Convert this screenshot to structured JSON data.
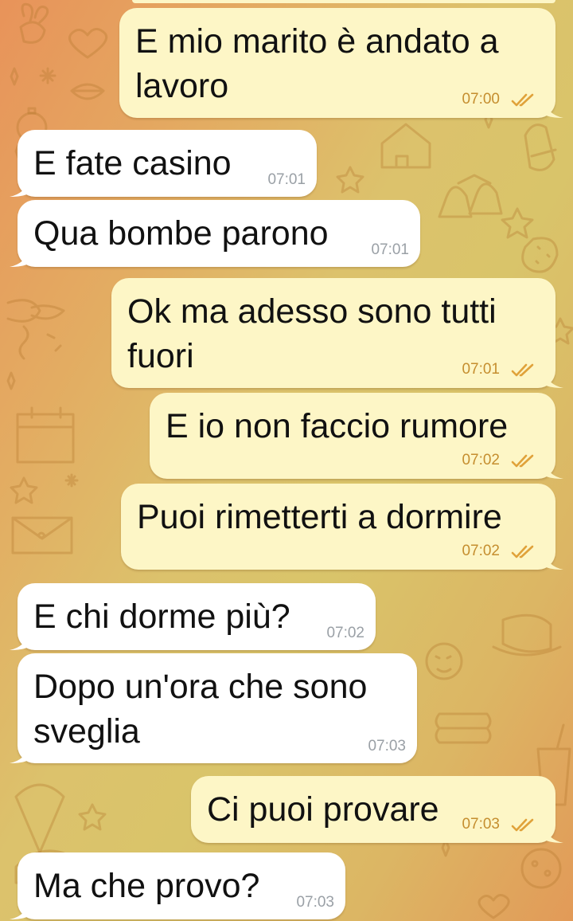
{
  "messages": [
    {
      "text": "E mio marito è andato a\nlavoro",
      "time": "07:00",
      "direction": "out",
      "status": "read"
    },
    {
      "text": "E fate casino",
      "time": "07:01",
      "direction": "in"
    },
    {
      "text": "Qua bombe parono",
      "time": "07:01",
      "direction": "in"
    },
    {
      "text": "Ok ma adesso sono tutti\nfuori",
      "time": "07:01",
      "direction": "out",
      "status": "read"
    },
    {
      "text": "E io non faccio rumore",
      "time": "07:02",
      "direction": "out",
      "status": "read"
    },
    {
      "text": "Puoi rimetterti a dormire",
      "time": "07:02",
      "direction": "out",
      "status": "read"
    },
    {
      "text": "E chi dorme più?",
      "time": "07:02",
      "direction": "in"
    },
    {
      "text": "Dopo un'ora che sono\nsveglia",
      "time": "07:03",
      "direction": "in"
    },
    {
      "text": "Ci puoi provare",
      "time": "07:03",
      "direction": "out",
      "status": "read"
    },
    {
      "text": "Ma che provo?",
      "time": "07:03",
      "direction": "in"
    }
  ],
  "colors": {
    "outgoing_bubble": "#fdf6c6",
    "incoming_bubble": "#ffffff",
    "outgoing_time": "#c58e2f",
    "incoming_time": "#9aa0a6",
    "read_check": "#e0a23a"
  },
  "icons": {
    "read_status": "double-check-icon",
    "wallpaper": "doodle-pattern"
  }
}
